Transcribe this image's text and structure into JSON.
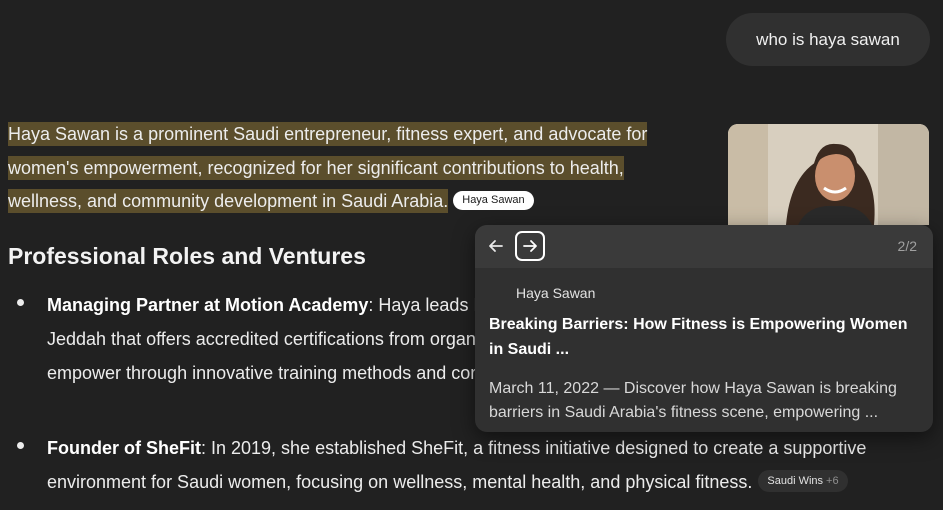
{
  "user_message": "who is haya sawan",
  "answer": {
    "intro": "Haya Sawan is a prominent Saudi entrepreneur, fitness expert, and advocate for women's empowerment, recognized for her significant contributions to health, wellness, and community development in Saudi Arabia.",
    "intro_citation": "Haya Sawan",
    "section_title": "Professional Roles and Ventures",
    "bullets": [
      {
        "bold": "Managing Partner at Motion Academy",
        "text": ": Haya leads Motion Academy, a fitness and wellness center in Jeddah that offers accredited certifications from organizations like NASM, AFAA, TRX, and Pilates, aiming to empower through innovative training methods and community-centered approaches."
      },
      {
        "bold": "Founder of SheFit",
        "text": ": In 2019, she established SheFit, a fitness initiative designed to create a supportive environment for Saudi women, focusing on wellness, mental health, and physical fitness.",
        "source_label": "Saudi Wins",
        "source_more": "+6"
      }
    ]
  },
  "citation_popover": {
    "prev_icon": "arrow-left-icon",
    "next_icon": "arrow-right-icon",
    "pager": "2/2",
    "source": "Haya Sawan",
    "title": "Breaking Barriers: How Fitness is Empowering Women in Saudi ...",
    "snippet": "March 11, 2022 — Discover how Haya Sawan is breaking barriers in Saudi Arabia's fitness scene, empowering ..."
  },
  "colors": {
    "background": "#212121",
    "highlight": "#5b4e2c",
    "popover": "#303030"
  }
}
